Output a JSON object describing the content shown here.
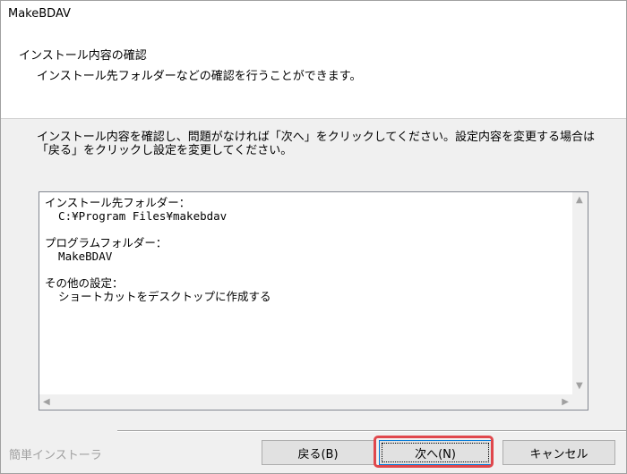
{
  "window": {
    "title": "MakeBDAV"
  },
  "header": {
    "title": "インストール内容の確認",
    "subtitle": "インストール先フォルダーなどの確認を行うことができます。"
  },
  "instruction": "インストール内容を確認し、問題がなければ「次へ」をクリックしてください。設定内容を変更する場合は「戻る」をクリックし設定を変更してください。",
  "summary": {
    "text": "インストール先フォルダー：\n  C:¥Program Files¥makebdav\n\nプログラムフォルダー：\n  MakeBDAV\n\nその他の設定：\n  ショートカットをデスクトップに作成する"
  },
  "footer": {
    "label": "簡単インストーラ",
    "back_label": "戻る(B)",
    "next_label": "次へ(N)",
    "cancel_label": "キャンセル"
  },
  "colors": {
    "highlight": "#e0474c",
    "focus": "#0078d7"
  }
}
